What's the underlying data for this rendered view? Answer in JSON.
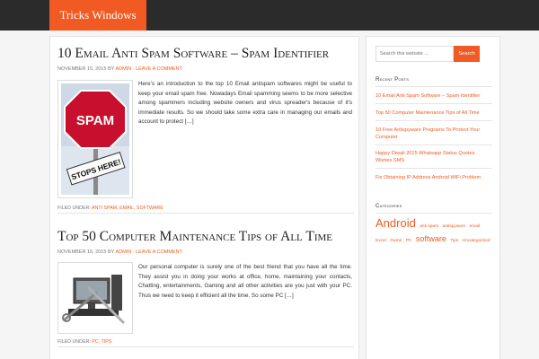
{
  "header": {
    "logo_text": "Tricks Windows"
  },
  "posts": [
    {
      "title": "10 Email Anti Spam Software – Spam Identifier",
      "date": "November 15, 2015",
      "by": "by",
      "author": "admin",
      "sep": "·",
      "comment_link": "Leave a Comment",
      "excerpt": "Here's an introduction to the top 10 Email antispam softwares might be useful to keep your email spam free. Nowadays Email spamming seems to be more selective among spammers including website owners and virus spreader's because of it's immediate results. So we should take some extra care in managing our emails and account to protect […]",
      "filed_label": "Filed Under:",
      "categories": "anti spam, email, software",
      "thumb_sign": "SPAM",
      "thumb_plate": "STOPS HERE!"
    },
    {
      "title": "Top 50 Computer Maintenance Tips of All Time",
      "date": "November 15, 2015",
      "by": "by",
      "author": "admin",
      "sep": "·",
      "comment_link": "Leave a Comment",
      "excerpt": "Our personal computer is surely one of the best friend that you have all the time. They assist you in doing your works at office, home, maintaining your contacts, Chatting, entertainments, Gaming and all other activities are you just with your PC. Thus we need to keep it efficient all the time. So some PC […]",
      "filed_label": "Filed Under:",
      "categories": "PC, Tips"
    }
  ],
  "sidebar": {
    "search_placeholder": "Search this website …",
    "search_button": "Search",
    "recent_title": "Recent Posts",
    "recent": [
      "10 Email Anti Spam Software – Spam Identifier",
      "Top 50 Computer Maintenance Tips of All Time",
      "10 Free Antispyware Programs To Protect Your Computer",
      "Happy Diwali 2015 Whatsapp Status Quotes Wishes SMS",
      "Fix Obtaining IP Address Android WiFi Problem"
    ],
    "categories_title": "Categories",
    "tags": [
      "Android",
      "anti spam",
      "antispyware",
      "email",
      "Excel",
      "Game",
      "PC",
      "software",
      "Tips",
      "Uncategorized"
    ]
  },
  "colors": {
    "accent": "#f15a23",
    "topbar": "#2b2b2b",
    "page_bg": "#f5f5f5"
  }
}
